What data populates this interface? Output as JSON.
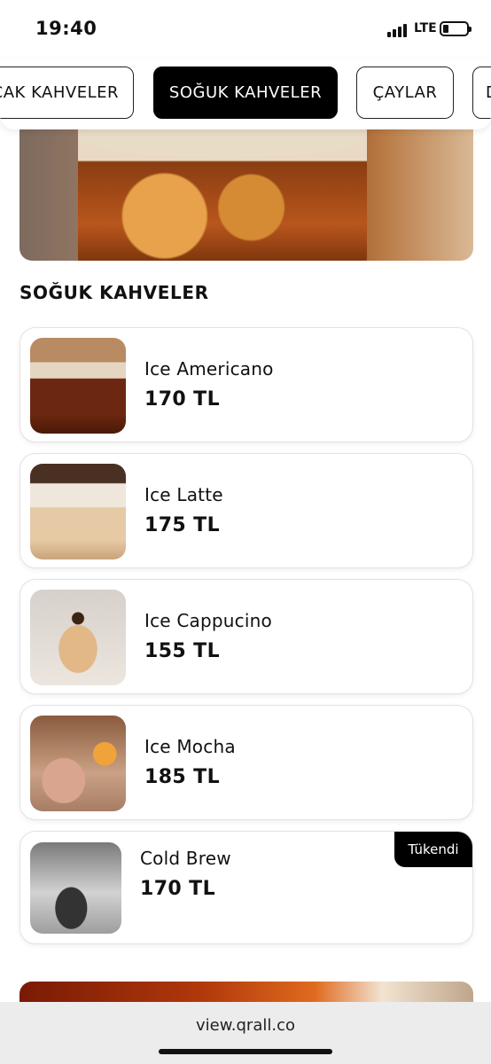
{
  "status_bar": {
    "time": "19:40",
    "network": "LTE"
  },
  "tabs": [
    {
      "label": "CAK KAHVELER",
      "active": false
    },
    {
      "label": "SOĞUK KAHVELER",
      "active": true
    },
    {
      "label": "ÇAYLAR",
      "active": false
    },
    {
      "label": "D",
      "active": false
    }
  ],
  "section": {
    "title": "SOĞUK KAHVELER"
  },
  "products": [
    {
      "name": "Ice Americano",
      "price": "170 TL"
    },
    {
      "name": "Ice Latte",
      "price": "175 TL"
    },
    {
      "name": "Ice Cappucino",
      "price": "155 TL"
    },
    {
      "name": "Ice Mocha",
      "price": "185 TL"
    },
    {
      "name": "Cold Brew",
      "price": "170 TL",
      "badge": "Tükendi"
    }
  ],
  "browser": {
    "url": "view.qrall.co"
  },
  "colors": {
    "accent": "#000000",
    "background": "#ffffff",
    "card_border": "#e2e2e2"
  }
}
